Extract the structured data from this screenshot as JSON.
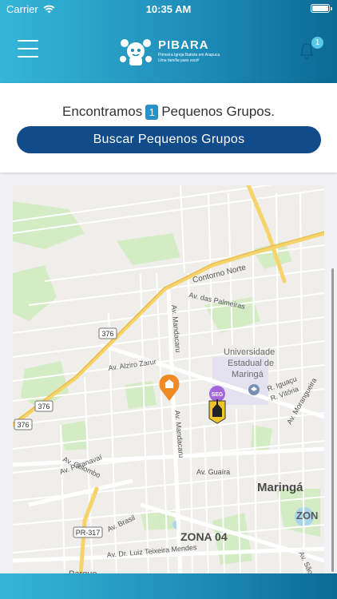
{
  "status_bar": {
    "carrier": "Carrier",
    "time": "10:35 AM"
  },
  "header": {
    "logo_title": "PIBARA",
    "logo_subtitle": "Primeira Igreja Batista em Arapuca",
    "logo_tagline": "Uma família para você!",
    "notification_count": "1",
    "colors": {
      "gradient_start": "#35b6d8",
      "gradient_end": "#0b6a95"
    }
  },
  "results": {
    "prefix": "Encontramos",
    "count": "1",
    "suffix": "Pequenos Grupos.",
    "search_button_label": "Buscar Pequenos Grupos",
    "button_color": "#114b8a"
  },
  "map": {
    "labels": {
      "contorno_norte": "Contorno Norte",
      "av_palmeiras": "Av. das Palmeiras",
      "av_mandacaru_1": "Av. Mandacaru",
      "av_mandacaru_2": "Av. Mandacaru",
      "universidade_1": "Universidade",
      "universidade_2": "Estadual de",
      "universidade_3": "Maringá",
      "route_376_a": "376",
      "route_376_b": "376",
      "route_376_c": "376",
      "av_alziro": "Av. Alziro Zarur",
      "r_iguacu": "R. Iguaçu",
      "r_vitoria": "R. Vitória",
      "av_morangueira": "Av. Morangueira",
      "av_colombo": "Av. Colombo",
      "av_paranavai": "Av. Paranavaí",
      "av_guaira": "Av. Guaíra",
      "maringa": "Maringá",
      "zona_right": "ZON",
      "pr317": "PR-317",
      "av_brasil": "Av. Brasil",
      "zona04": "ZONA 04",
      "av_luiz": "Av. Dr. Luiz Teixeira Mendes",
      "av_sao_paulo": "Av. São Paulo",
      "parque": "Parque",
      "seg_marker": "SEG"
    }
  }
}
